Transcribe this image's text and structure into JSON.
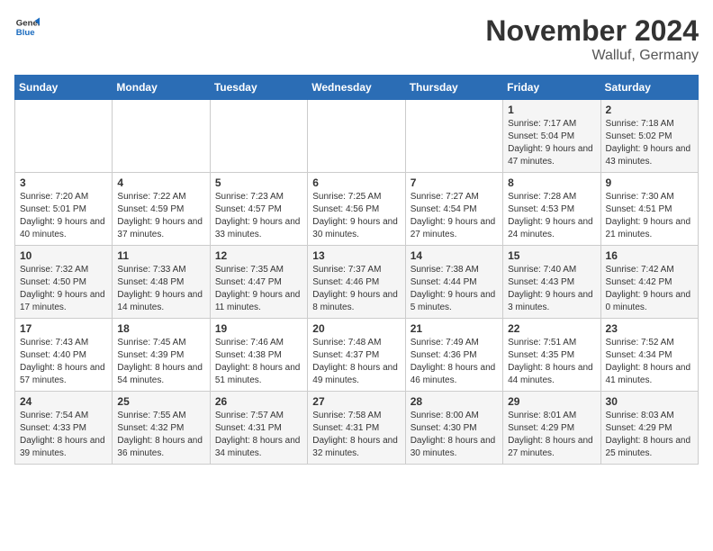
{
  "header": {
    "logo": {
      "general": "General",
      "blue": "Blue"
    },
    "title": "November 2024",
    "location": "Walluf, Germany"
  },
  "weekdays": [
    "Sunday",
    "Monday",
    "Tuesday",
    "Wednesday",
    "Thursday",
    "Friday",
    "Saturday"
  ],
  "weeks": [
    [
      {
        "day": "",
        "info": ""
      },
      {
        "day": "",
        "info": ""
      },
      {
        "day": "",
        "info": ""
      },
      {
        "day": "",
        "info": ""
      },
      {
        "day": "",
        "info": ""
      },
      {
        "day": "1",
        "info": "Sunrise: 7:17 AM\nSunset: 5:04 PM\nDaylight: 9 hours and 47 minutes."
      },
      {
        "day": "2",
        "info": "Sunrise: 7:18 AM\nSunset: 5:02 PM\nDaylight: 9 hours and 43 minutes."
      }
    ],
    [
      {
        "day": "3",
        "info": "Sunrise: 7:20 AM\nSunset: 5:01 PM\nDaylight: 9 hours and 40 minutes."
      },
      {
        "day": "4",
        "info": "Sunrise: 7:22 AM\nSunset: 4:59 PM\nDaylight: 9 hours and 37 minutes."
      },
      {
        "day": "5",
        "info": "Sunrise: 7:23 AM\nSunset: 4:57 PM\nDaylight: 9 hours and 33 minutes."
      },
      {
        "day": "6",
        "info": "Sunrise: 7:25 AM\nSunset: 4:56 PM\nDaylight: 9 hours and 30 minutes."
      },
      {
        "day": "7",
        "info": "Sunrise: 7:27 AM\nSunset: 4:54 PM\nDaylight: 9 hours and 27 minutes."
      },
      {
        "day": "8",
        "info": "Sunrise: 7:28 AM\nSunset: 4:53 PM\nDaylight: 9 hours and 24 minutes."
      },
      {
        "day": "9",
        "info": "Sunrise: 7:30 AM\nSunset: 4:51 PM\nDaylight: 9 hours and 21 minutes."
      }
    ],
    [
      {
        "day": "10",
        "info": "Sunrise: 7:32 AM\nSunset: 4:50 PM\nDaylight: 9 hours and 17 minutes."
      },
      {
        "day": "11",
        "info": "Sunrise: 7:33 AM\nSunset: 4:48 PM\nDaylight: 9 hours and 14 minutes."
      },
      {
        "day": "12",
        "info": "Sunrise: 7:35 AM\nSunset: 4:47 PM\nDaylight: 9 hours and 11 minutes."
      },
      {
        "day": "13",
        "info": "Sunrise: 7:37 AM\nSunset: 4:46 PM\nDaylight: 9 hours and 8 minutes."
      },
      {
        "day": "14",
        "info": "Sunrise: 7:38 AM\nSunset: 4:44 PM\nDaylight: 9 hours and 5 minutes."
      },
      {
        "day": "15",
        "info": "Sunrise: 7:40 AM\nSunset: 4:43 PM\nDaylight: 9 hours and 3 minutes."
      },
      {
        "day": "16",
        "info": "Sunrise: 7:42 AM\nSunset: 4:42 PM\nDaylight: 9 hours and 0 minutes."
      }
    ],
    [
      {
        "day": "17",
        "info": "Sunrise: 7:43 AM\nSunset: 4:40 PM\nDaylight: 8 hours and 57 minutes."
      },
      {
        "day": "18",
        "info": "Sunrise: 7:45 AM\nSunset: 4:39 PM\nDaylight: 8 hours and 54 minutes."
      },
      {
        "day": "19",
        "info": "Sunrise: 7:46 AM\nSunset: 4:38 PM\nDaylight: 8 hours and 51 minutes."
      },
      {
        "day": "20",
        "info": "Sunrise: 7:48 AM\nSunset: 4:37 PM\nDaylight: 8 hours and 49 minutes."
      },
      {
        "day": "21",
        "info": "Sunrise: 7:49 AM\nSunset: 4:36 PM\nDaylight: 8 hours and 46 minutes."
      },
      {
        "day": "22",
        "info": "Sunrise: 7:51 AM\nSunset: 4:35 PM\nDaylight: 8 hours and 44 minutes."
      },
      {
        "day": "23",
        "info": "Sunrise: 7:52 AM\nSunset: 4:34 PM\nDaylight: 8 hours and 41 minutes."
      }
    ],
    [
      {
        "day": "24",
        "info": "Sunrise: 7:54 AM\nSunset: 4:33 PM\nDaylight: 8 hours and 39 minutes."
      },
      {
        "day": "25",
        "info": "Sunrise: 7:55 AM\nSunset: 4:32 PM\nDaylight: 8 hours and 36 minutes."
      },
      {
        "day": "26",
        "info": "Sunrise: 7:57 AM\nSunset: 4:31 PM\nDaylight: 8 hours and 34 minutes."
      },
      {
        "day": "27",
        "info": "Sunrise: 7:58 AM\nSunset: 4:31 PM\nDaylight: 8 hours and 32 minutes."
      },
      {
        "day": "28",
        "info": "Sunrise: 8:00 AM\nSunset: 4:30 PM\nDaylight: 8 hours and 30 minutes."
      },
      {
        "day": "29",
        "info": "Sunrise: 8:01 AM\nSunset: 4:29 PM\nDaylight: 8 hours and 27 minutes."
      },
      {
        "day": "30",
        "info": "Sunrise: 8:03 AM\nSunset: 4:29 PM\nDaylight: 8 hours and 25 minutes."
      }
    ]
  ]
}
